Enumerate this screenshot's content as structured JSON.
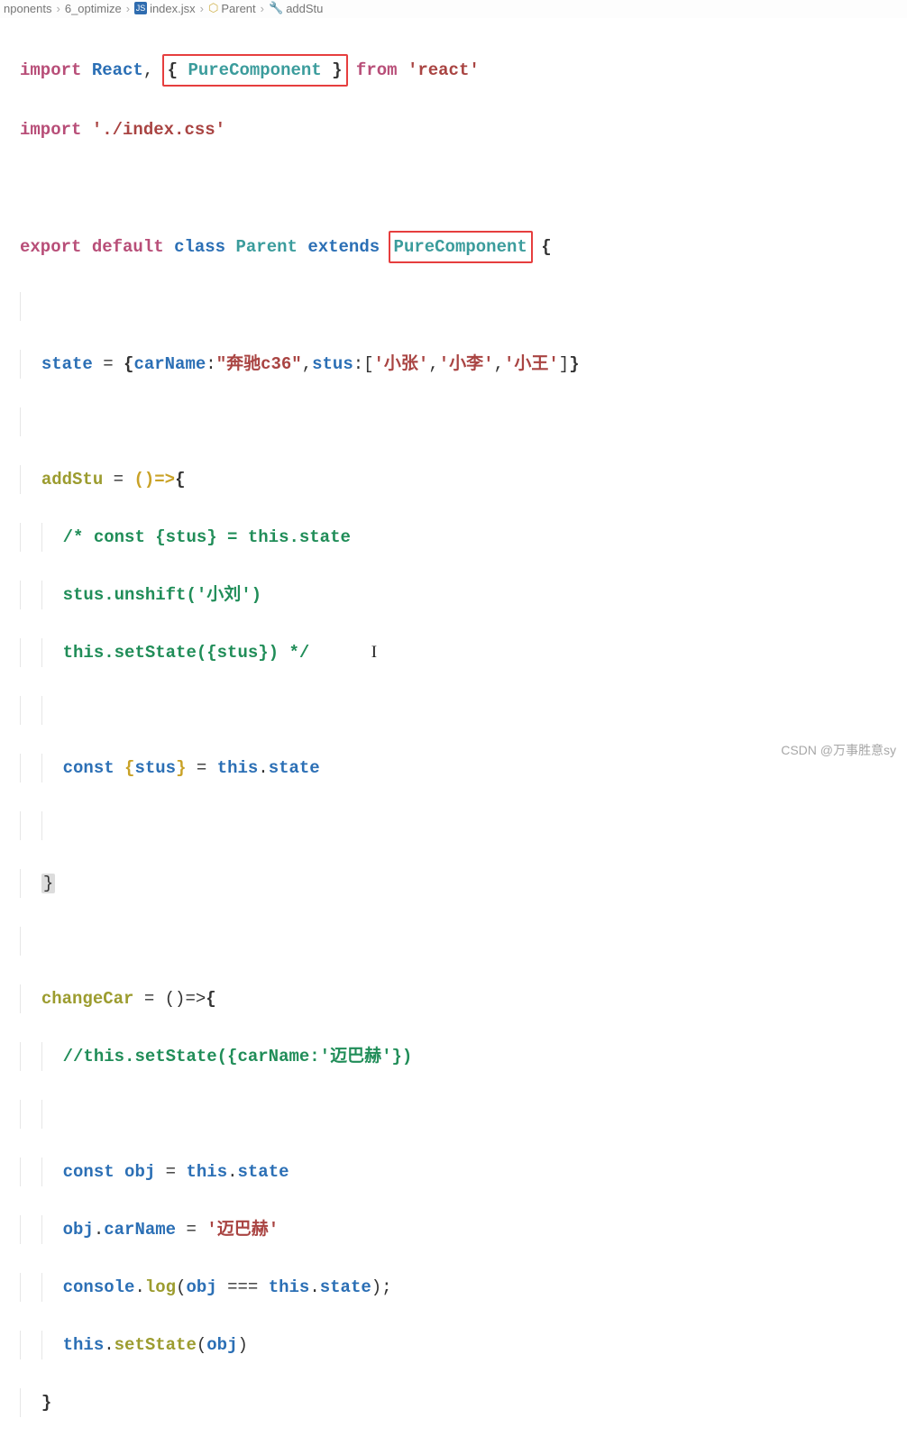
{
  "breadcrumb": {
    "folder1": "nponents",
    "folder2": "6_optimize",
    "file": "index.jsx",
    "class": "Parent",
    "method": "addStu"
  },
  "highlight_boxes": {
    "import_clause": "{ PureComponent }",
    "extends_target": "PureComponent"
  },
  "code": {
    "l1": {
      "kw1": "import",
      "ident": "React",
      "comma": ", ",
      "brace_open": "{ ",
      "pure": "PureComponent",
      "brace_close": " }",
      "kw2": "from",
      "str": "'react'"
    },
    "l2": {
      "kw1": "import",
      "str": "'./index.css'"
    },
    "l4": {
      "kw1": "export",
      "kw2": "default",
      "kw3": "class",
      "name": "Parent",
      "kw4": "extends",
      "ext": "PureComponent",
      "brace": "{"
    },
    "l6": {
      "prop": "state",
      "eq": " = ",
      "open": "{",
      "key1": "carName",
      "colon1": ":",
      "val1": "\"奔驰c36\"",
      "comma1": ",",
      "key2": "stus",
      "colon2": ":",
      "arr_open": "[",
      "a1": "'小张'",
      "c1": ",",
      "a2": "'小李'",
      "c2": ",",
      "a3": "'小王'",
      "arr_close": "]",
      "close": "}"
    },
    "l8": {
      "prop": "addStu",
      "eq": " = ",
      "arrow": "()=>",
      "brace": "{"
    },
    "l9": {
      "c": "/* const {stus} = this.state"
    },
    "l10": {
      "c": "stus.unshift('小刘')"
    },
    "l11": {
      "c": "this.setState({stus}) */"
    },
    "l13": {
      "kw": "const",
      "open": "{",
      "v": "stus",
      "close": "}",
      "eq": " = ",
      "this": "this",
      "dot": ".",
      "prop": "state"
    },
    "l15": {
      "brace": "}"
    },
    "l17": {
      "prop": "changeCar",
      "eq": " = ",
      "arrow": "()=>",
      "brace": "{"
    },
    "l18": {
      "c": "//this.setState({carName:'迈巴赫'})"
    },
    "l20": {
      "kw": "const",
      "v": "obj",
      "eq": " = ",
      "this": "this",
      "dot": ".",
      "prop": "state"
    },
    "l21": {
      "obj": "obj",
      "dot": ".",
      "prop": "carName",
      "eq": " = ",
      "str": "'迈巴赫'"
    },
    "l22": {
      "obj": "console",
      "dot": ".",
      "fn": "log",
      "open": "(",
      "a": "obj",
      "op": " === ",
      "this": "this",
      "dot2": ".",
      "prop": "state",
      "close": ")",
      "semi": ";"
    },
    "l23": {
      "this": "this",
      "dot": ".",
      "fn": "setState",
      "open": "(",
      "arg": "obj",
      "close": ")"
    },
    "l24": {
      "brace": "}"
    }
  },
  "watermark": "CSDN @万事胜意sy"
}
